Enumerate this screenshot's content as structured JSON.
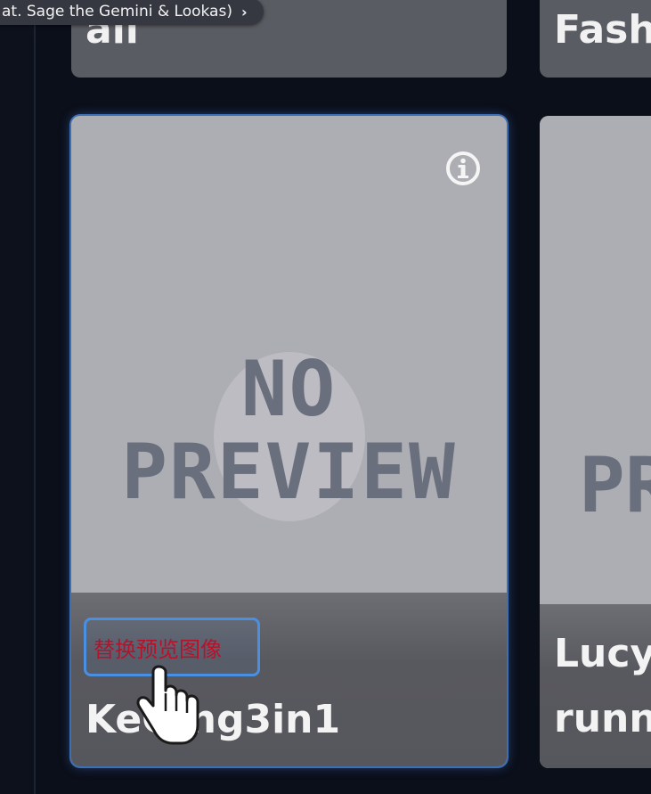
{
  "tag_pill": {
    "label": "at. Sage the Gemini & Lookas)",
    "chevron": "›"
  },
  "top_cards": {
    "left_title": "ail",
    "right_title": "Fashi"
  },
  "main_card": {
    "placeholder": {
      "line1": "NO",
      "line2": "PREVIEW"
    },
    "info_icon": "info-icon",
    "chip_label": "替换预览图像",
    "name": "KeQing3in1"
  },
  "side_card": {
    "placeholder": "PR",
    "line1": "Lucy(",
    "line2": "runn"
  },
  "colors": {
    "card_preview": "#adaeb3",
    "card_footer": "#56575d",
    "selection_blue": "#4a90e2",
    "chip_text": "#b8122b"
  }
}
